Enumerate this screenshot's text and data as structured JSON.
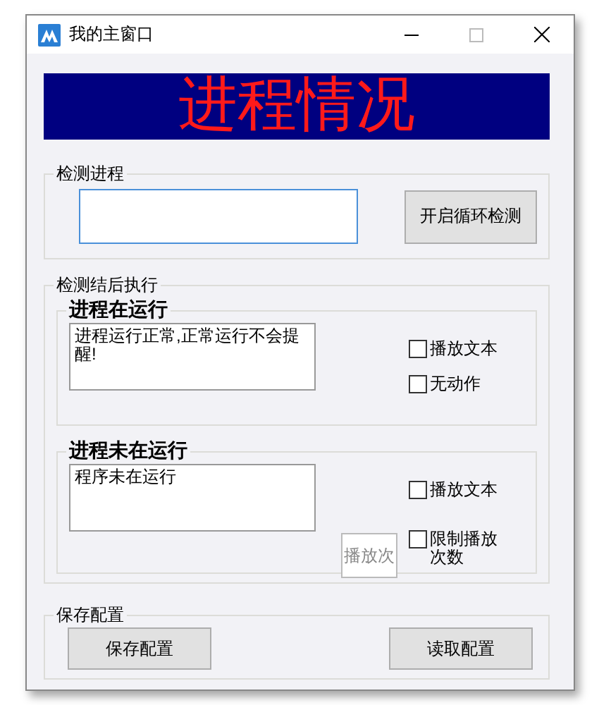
{
  "window": {
    "title": "我的主窗口"
  },
  "banner": {
    "text": "进程情况"
  },
  "detect_group": {
    "title": "检测进程",
    "input": {
      "focused": true
    },
    "button": "开启循环检测"
  },
  "action_group": {
    "title": "检测结后执行",
    "sections": [
      {
        "title": "进程在运行",
        "message": "进程运行正常,正常运行不会提醒!",
        "options": [
          {
            "label": "播放文本",
            "checked": false
          },
          {
            "label": "无动作",
            "checked": false
          }
        ]
      },
      {
        "title": "进程未在运行",
        "message": "程序未在运行",
        "options": [
          {
            "label": "播放文本",
            "checked": false
          },
          {
            "label": "限制播放次数",
            "checked": false
          }
        ],
        "count_button": {
          "label": "播放次",
          "disabled": true
        }
      }
    ]
  },
  "config_group": {
    "title": "保存配置",
    "buttons": [
      "保存配置",
      "读取配置"
    ]
  }
}
